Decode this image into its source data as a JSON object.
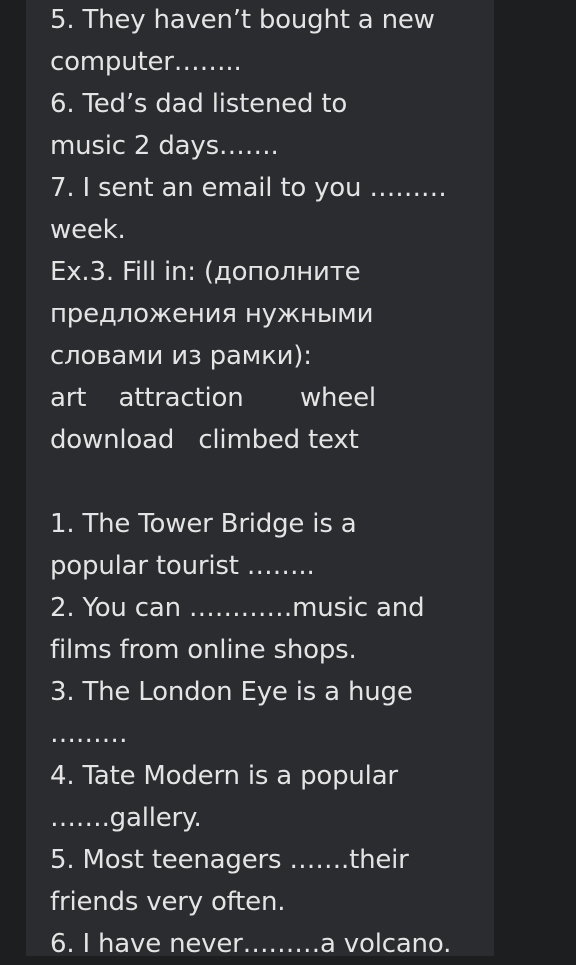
{
  "lines": [
    "5. They haven’t bought a new",
    "computer……..",
    "6. Ted’s dad listened to",
    "music 2 days…….",
    "7. I sent an email to you ………",
    "week.",
    "Ex.3. Fill in: (дополните",
    "предложения нужными",
    "словами из рамки):",
    "art    attraction       wheel",
    "download   climbed text",
    "",
    "1. The Tower Bridge is a",
    "popular tourist ……..",
    "2. You can …………music and",
    "films from online shops.",
    "3. The London Eye is a huge",
    "………",
    "4. Tate Modern is a popular",
    "…….gallery.",
    "5. Most teenagers …….their",
    "friends very often.",
    "6. I have never………a volcano."
  ]
}
